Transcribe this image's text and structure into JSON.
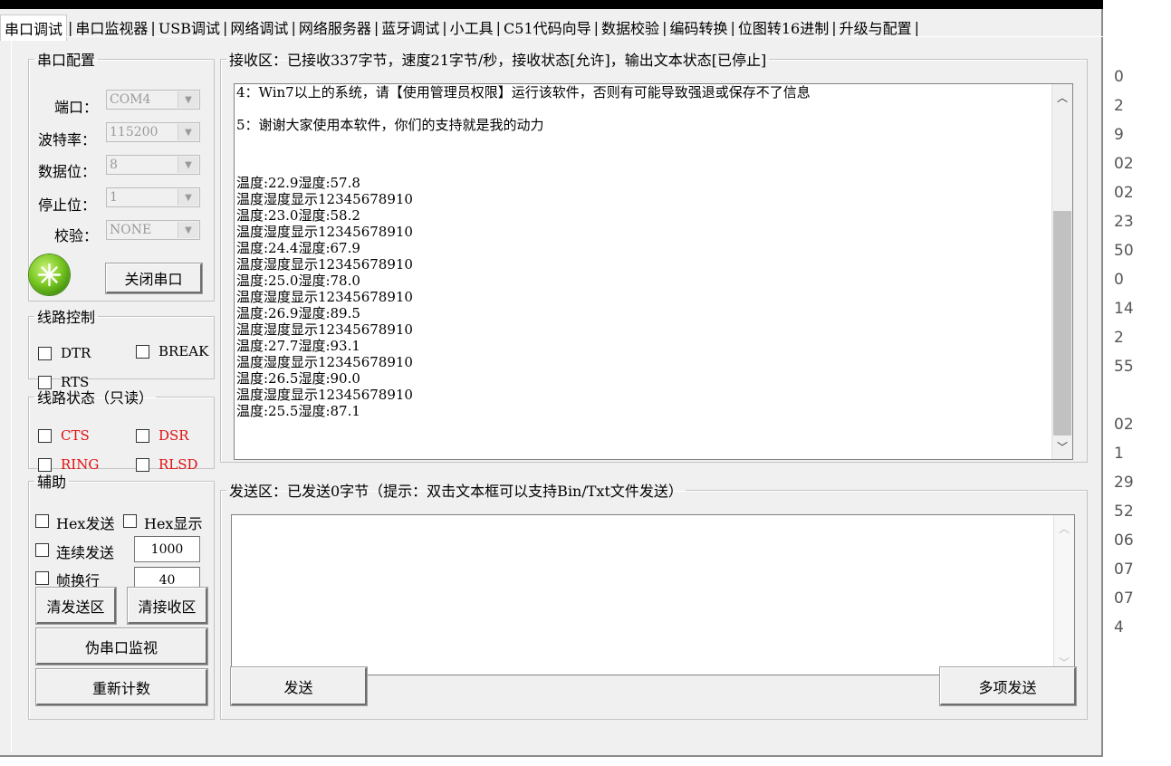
{
  "tabs": [
    "串口调试",
    "串口监视器",
    "USB调试",
    "网络调试",
    "网络服务器",
    "蓝牙调试",
    "小工具",
    "C51代码向导",
    "数据校验",
    "编码转换",
    "位图转16进制",
    "升级与配置"
  ],
  "serial_config": {
    "legend": "串口配置",
    "port_label": "端口：",
    "port_value": "COM4",
    "baud_label": "波特率：",
    "baud_value": "115200",
    "databits_label": "数据位：",
    "databits_value": "8",
    "stopbits_label": "停止位：",
    "stopbits_value": "1",
    "parity_label": "校验：",
    "parity_value": "NONE",
    "close_button": "关闭串口"
  },
  "line_control": {
    "legend": "线路控制",
    "dtr": "DTR",
    "brk": "BREAK",
    "rts": "RTS"
  },
  "line_status": {
    "legend": "线路状态（只读）",
    "cts": "CTS",
    "dsr": "DSR",
    "ring": "RING",
    "rlsd": "RLSD"
  },
  "aux": {
    "legend": "辅助",
    "hex_send": "Hex发送",
    "hex_show": "Hex显示",
    "cont_send": "连续发送",
    "cont_value": "1000",
    "frame_newline": "帧换行",
    "frame_value": "40",
    "clear_send": "清发送区",
    "clear_recv": "清接收区",
    "fake_monitor": "伪串口监视",
    "recount": "重新计数"
  },
  "receive": {
    "legend": "接收区：已接收337字节，速度21字节/秒，接收状态[允许]，输出文本状态[已停止]",
    "notices": [
      "4：Win7以上的系统，请【使用管理员权限】运行该软件，否则有可能导致强退或保存不了信息",
      "5：谢谢大家使用本软件，你们的支持就是我的动力"
    ],
    "lines": [
      "温度:22.9湿度:57.8",
      "温度湿度显示12345678910",
      "温度:23.0湿度:58.2",
      "温度湿度显示12345678910",
      "温度:24.4湿度:67.9",
      "温度湿度显示12345678910",
      "温度:25.0湿度:78.0",
      "温度湿度显示12345678910",
      "温度:26.9湿度:89.5",
      "温度湿度显示12345678910",
      "温度:27.7湿度:93.1",
      "温度湿度显示12345678910",
      "温度:26.5湿度:90.0",
      "温度湿度显示12345678910",
      "温度:25.5湿度:87.1"
    ]
  },
  "send_area": {
    "legend": "发送区：已发送0字节（提示：双击文本框可以支持Bin/Txt文件发送）",
    "send_button": "发送",
    "multi_send_button": "多项发送"
  },
  "background_list": [
    "0",
    "2",
    "9",
    "02",
    "02",
    "23",
    "50",
    "0",
    "14",
    "2",
    "55",
    "",
    "02",
    "1",
    "29",
    "52",
    "06",
    "07",
    "07",
    "4"
  ]
}
